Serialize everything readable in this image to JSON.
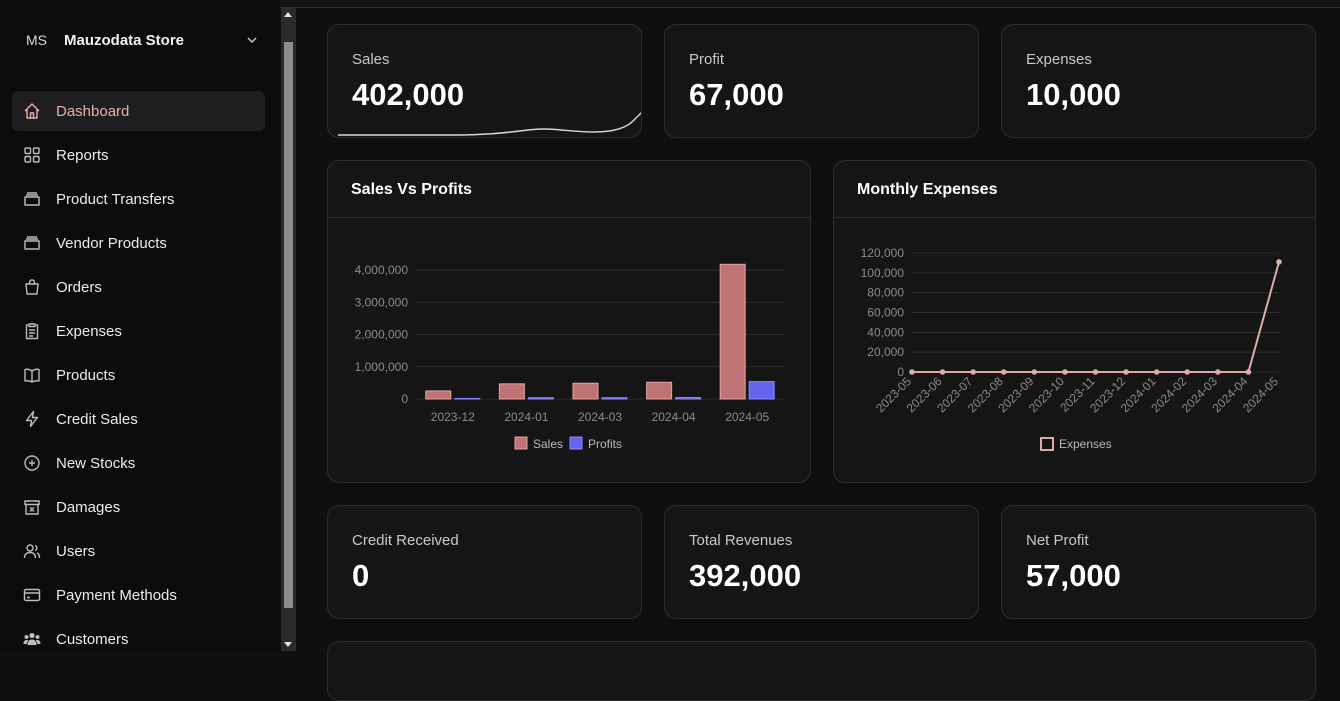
{
  "store": {
    "initials": "MS",
    "name": "Mauzodata Store"
  },
  "nav": [
    {
      "label": "Dashboard",
      "icon": "home-icon",
      "active": true
    },
    {
      "label": "Reports",
      "icon": "grid-icon"
    },
    {
      "label": "Product Transfers",
      "icon": "box-icon"
    },
    {
      "label": "Vendor Products",
      "icon": "box-icon"
    },
    {
      "label": "Orders",
      "icon": "shopping-bag-icon"
    },
    {
      "label": "Expenses",
      "icon": "clipboard-icon"
    },
    {
      "label": "Products",
      "icon": "book-icon"
    },
    {
      "label": "Credit Sales",
      "icon": "lightning-icon"
    },
    {
      "label": "New Stocks",
      "icon": "plus-circle-icon"
    },
    {
      "label": "Damages",
      "icon": "archive-x-icon"
    },
    {
      "label": "Users",
      "icon": "users-icon"
    },
    {
      "label": "Payment Methods",
      "icon": "credit-card-icon"
    },
    {
      "label": "Customers",
      "icon": "group-icon"
    }
  ],
  "stats_top": [
    {
      "label": "Sales",
      "value": "402,000"
    },
    {
      "label": "Profit",
      "value": "67,000"
    },
    {
      "label": "Expenses",
      "value": "10,000"
    }
  ],
  "stats_bottom": [
    {
      "label": "Credit Received",
      "value": "0"
    },
    {
      "label": "Total Revenues",
      "value": "392,000"
    },
    {
      "label": "Net Profit",
      "value": "57,000"
    }
  ],
  "colors": {
    "sales": "#c07374",
    "profits": "#6464f0",
    "expenses": "#e0aaa6",
    "accent": "#e6b1ac"
  },
  "chart_data": [
    {
      "type": "bar",
      "title": "Sales Vs Profits",
      "categories": [
        "2023-12",
        "2024-01",
        "2024-03",
        "2024-04",
        "2024-05"
      ],
      "series": [
        {
          "name": "Sales",
          "values": [
            250000,
            470000,
            490000,
            520000,
            4180000
          ]
        },
        {
          "name": "Profits",
          "values": [
            15000,
            40000,
            40000,
            45000,
            540000
          ]
        }
      ],
      "yticks": [
        "0",
        "1,000,000",
        "2,000,000",
        "3,000,000",
        "4,000,000"
      ],
      "ylim": [
        0,
        4500000
      ],
      "legend": "bottom"
    },
    {
      "type": "line",
      "title": "Monthly Expenses",
      "categories": [
        "2023-05",
        "2023-06",
        "2023-07",
        "2023-08",
        "2023-09",
        "2023-10",
        "2023-11",
        "2023-12",
        "2024-01",
        "2024-02",
        "2024-03",
        "2024-04",
        "2024-05"
      ],
      "series": [
        {
          "name": "Expenses",
          "values": [
            0,
            0,
            0,
            0,
            0,
            0,
            0,
            0,
            0,
            0,
            0,
            0,
            111000
          ]
        }
      ],
      "yticks": [
        "0",
        "20,000",
        "40,000",
        "60,000",
        "80,000",
        "100,000",
        "120,000"
      ],
      "ylim": [
        0,
        120000
      ],
      "legend": "bottom"
    }
  ]
}
